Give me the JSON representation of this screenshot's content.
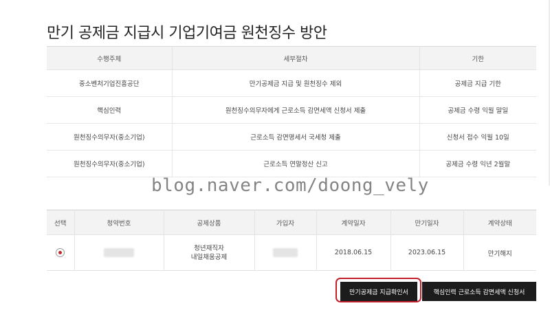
{
  "page_title": "만기 공제금 지급시 기업기여금 원천징수 방안",
  "procedure_table": {
    "headers": [
      "수행주체",
      "세부절차",
      "기한"
    ],
    "rows": [
      [
        "중소벤처기업진흥공단",
        "만기공제금 지급 및 원천징수 제외",
        "공제금 지급 기한"
      ],
      [
        "핵심인력",
        "원천징수의무자에게 근로소득 감면세액 신청서 제출",
        "공제금 수령 익월 말일"
      ],
      [
        "원천징수의무자(중소기업)",
        "근로소득 감면명세서 국세청 제출",
        "신청서 접수 익월 10일"
      ],
      [
        "원천징수의무자(중소기업)",
        "근로소득 연말정산 신고",
        "공제금 수령 익년 2월말"
      ]
    ]
  },
  "watermark": "blog.naver.com/doong_vely",
  "contract_table": {
    "headers": [
      "선택",
      "청약번호",
      "공제상품",
      "가입자",
      "계약일자",
      "만기일자",
      "계약상태"
    ],
    "row": {
      "selected": true,
      "product_line1": "청년재직자",
      "product_line2": "내일채움공제",
      "contract_date": "2018.06.15",
      "maturity_date": "2023.06.15",
      "status": "만기해지"
    }
  },
  "buttons": {
    "confirm": "만기공제금 지급확인서",
    "apply": "핵심인력 근로소득 감면세액 신청서"
  },
  "colors": {
    "highlight": "#c41e2a",
    "button_bg": "#1c1c1c",
    "header_bg": "#f3f3f3",
    "radio_dot": "#c0282d"
  }
}
